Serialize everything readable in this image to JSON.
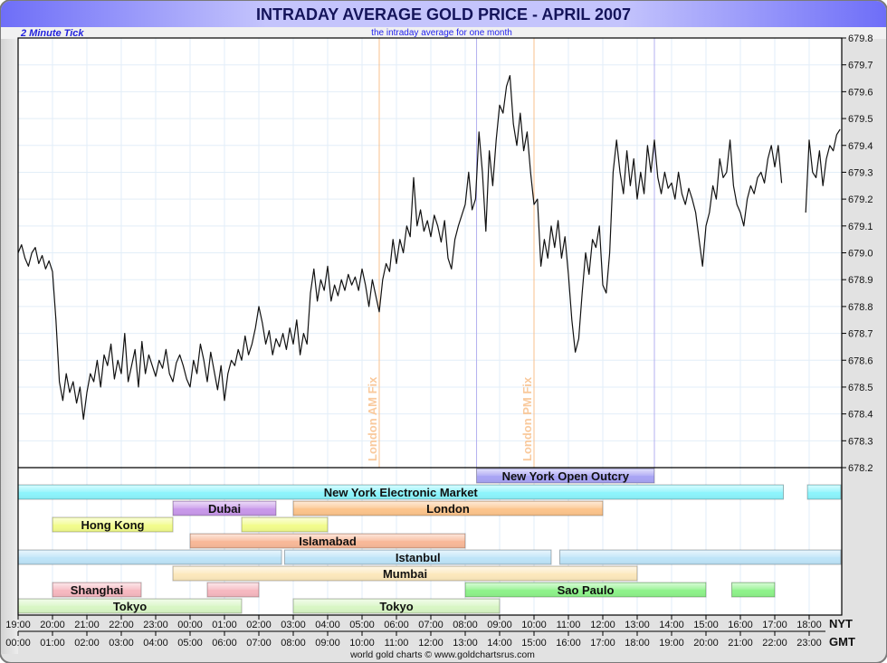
{
  "chart_data": {
    "type": "line",
    "title": "INTRADAY AVERAGE GOLD PRICE - APRIL 2007",
    "subtitle": "the intraday average for one month",
    "tick_note": "2 Minute Tick",
    "credit": "world gold charts © www.goldchartsrus.com",
    "ylim": [
      678.2,
      679.8
    ],
    "y_ticks": [
      "678.2",
      "678.3",
      "678.4",
      "678.5",
      "678.6",
      "678.7",
      "678.8",
      "678.9",
      "679.0",
      "679.1",
      "679.2",
      "679.3",
      "679.4",
      "679.5",
      "679.6",
      "679.7",
      "679.8"
    ],
    "x_axis_nyt_label": "NYT",
    "x_axis_gmt_label": "GMT",
    "x_ticks_nyt": [
      "19:00",
      "20:00",
      "21:00",
      "22:00",
      "23:00",
      "00:00",
      "01:00",
      "02:00",
      "03:00",
      "04:00",
      "05:00",
      "06:00",
      "07:00",
      "08:00",
      "09:00",
      "10:00",
      "11:00",
      "12:00",
      "13:00",
      "14:00",
      "15:00",
      "16:00",
      "17:00",
      "18:00"
    ],
    "x_ticks_gmt": [
      "00:00",
      "01:00",
      "02:00",
      "03:00",
      "04:00",
      "05:00",
      "06:00",
      "07:00",
      "08:00",
      "09:00",
      "10:00",
      "11:00",
      "12:00",
      "13:00",
      "14:00",
      "15:00",
      "16:00",
      "17:00",
      "18:00",
      "19:00",
      "20:00",
      "21:00",
      "22:00",
      "23:00"
    ],
    "series": [
      {
        "name": "Intraday average gold price",
        "start_hour_nyt": "19:00",
        "step_hours": 0.1,
        "values": [
          679.0,
          679.03,
          678.98,
          678.95,
          679.0,
          679.02,
          678.96,
          678.99,
          678.94,
          678.97,
          678.93,
          678.75,
          678.52,
          678.45,
          678.55,
          678.48,
          678.52,
          678.44,
          678.5,
          678.38,
          678.48,
          678.55,
          678.52,
          678.6,
          678.5,
          678.62,
          678.58,
          678.66,
          678.53,
          678.6,
          678.55,
          678.7,
          678.52,
          678.58,
          678.64,
          678.5,
          678.67,
          678.55,
          678.62,
          678.58,
          678.54,
          678.6,
          678.57,
          678.64,
          678.55,
          678.52,
          678.59,
          678.62,
          678.58,
          678.53,
          678.5,
          678.6,
          678.55,
          678.66,
          678.6,
          678.52,
          678.63,
          678.56,
          678.49,
          678.58,
          678.45,
          678.55,
          678.6,
          678.58,
          678.64,
          678.6,
          678.69,
          678.62,
          678.66,
          678.72,
          678.8,
          678.74,
          678.66,
          678.71,
          678.62,
          678.68,
          678.65,
          678.7,
          678.64,
          678.72,
          678.66,
          678.75,
          678.62,
          678.7,
          678.66,
          678.85,
          678.94,
          678.82,
          678.9,
          678.86,
          678.95,
          678.82,
          678.88,
          678.84,
          678.9,
          678.86,
          678.92,
          678.88,
          678.91,
          678.86,
          678.94,
          678.88,
          678.8,
          678.9,
          678.84,
          678.78,
          678.9,
          678.96,
          678.93,
          679.05,
          678.96,
          679.05,
          679.0,
          679.1,
          679.06,
          679.28,
          679.1,
          679.16,
          679.08,
          679.12,
          679.06,
          679.14,
          679.1,
          679.04,
          679.12,
          678.98,
          678.94,
          679.05,
          679.1,
          679.14,
          679.18,
          679.3,
          679.16,
          679.2,
          679.45,
          679.3,
          679.08,
          679.38,
          679.25,
          679.42,
          679.55,
          679.52,
          679.62,
          679.66,
          679.48,
          679.4,
          679.52,
          679.38,
          679.45,
          679.3,
          679.18,
          679.2,
          678.95,
          679.05,
          678.98,
          679.1,
          679.02,
          679.12,
          678.98,
          679.06,
          678.92,
          678.75,
          678.63,
          678.68,
          678.85,
          679.0,
          678.92,
          679.05,
          679.02,
          679.1,
          678.88,
          678.85,
          679.0,
          679.3,
          679.42,
          679.3,
          679.22,
          679.38,
          679.25,
          679.35,
          679.2,
          679.3,
          679.22,
          679.4,
          679.3,
          679.42,
          679.28,
          679.22,
          679.3,
          679.24,
          679.26,
          679.2,
          679.3,
          679.22,
          679.18,
          679.24,
          679.2,
          679.15,
          679.05,
          678.95,
          679.1,
          679.15,
          679.25,
          679.2,
          679.35,
          679.28,
          679.3,
          679.42,
          679.25,
          679.18,
          679.15,
          679.1,
          679.2,
          679.25,
          679.22,
          679.28,
          679.3,
          679.26,
          679.35,
          679.4,
          679.32,
          679.4,
          679.26,
          null,
          null,
          null,
          null,
          null,
          null,
          679.15,
          679.42,
          679.3,
          679.28,
          679.38,
          679.25,
          679.35,
          679.4,
          679.38,
          679.44,
          679.46
        ]
      }
    ],
    "annotations": [
      {
        "label": "London AM Fix",
        "hour_offset": 10.5,
        "color": "#f8c08e"
      },
      {
        "label": "London PM Fix",
        "hour_offset": 15.0,
        "color": "#f8c08e"
      }
    ],
    "markers": [
      {
        "hour_offset": 13.33,
        "color": "#b4b0f0"
      },
      {
        "hour_offset": 18.5,
        "color": "#b4b0f0"
      }
    ],
    "markets": [
      {
        "name": "New York Open Outcry",
        "row": 0,
        "color": "#a8a4f4",
        "segments": [
          {
            "start": 13.33,
            "end": 18.5,
            "labeled": true
          }
        ]
      },
      {
        "name": "New York Electronic Market",
        "row": 1,
        "color": "#8cf4fc",
        "segments": [
          {
            "start": 0,
            "end": 22.25,
            "labeled": true
          },
          {
            "start": 22.95,
            "end": 23.92,
            "labeled": false
          }
        ]
      },
      {
        "name": "Dubai",
        "row": 2,
        "color": "#c898ea",
        "segments": [
          {
            "start": 4.5,
            "end": 7.5,
            "labeled": true
          }
        ]
      },
      {
        "name": "London",
        "row": 2,
        "color": "#fcc48c",
        "segments": [
          {
            "start": 8,
            "end": 17,
            "labeled": true
          }
        ]
      },
      {
        "name": "Hong Kong",
        "row": 3,
        "color": "#f2fc8c",
        "segments": [
          {
            "start": 1,
            "end": 4.5,
            "labeled": true
          },
          {
            "start": 6.5,
            "end": 9,
            "labeled": false
          }
        ]
      },
      {
        "name": "Islamabad",
        "row": 4,
        "color": "#f8b898",
        "segments": [
          {
            "start": 5,
            "end": 13,
            "labeled": true
          }
        ]
      },
      {
        "name": "Istanbul",
        "row": 5,
        "color": "#bee4f8",
        "segments": [
          {
            "start": 0,
            "end": 7.66,
            "labeled": false
          },
          {
            "start": 7.75,
            "end": 15.5,
            "labeled": true
          },
          {
            "start": 15.75,
            "end": 23.92,
            "labeled": false
          }
        ]
      },
      {
        "name": "Mumbai",
        "row": 6,
        "color": "#fce8bc",
        "segments": [
          {
            "start": 4.5,
            "end": 18,
            "labeled": true
          }
        ]
      },
      {
        "name": "Shanghai",
        "row": 7,
        "color": "#f6b8c0",
        "segments": [
          {
            "start": 1,
            "end": 3.58,
            "labeled": true
          },
          {
            "start": 5.5,
            "end": 7,
            "labeled": false
          }
        ]
      },
      {
        "name": "Sao Paulo",
        "row": 7,
        "color": "#8ef28a",
        "segments": [
          {
            "start": 13,
            "end": 20,
            "labeled": true
          },
          {
            "start": 20.75,
            "end": 22,
            "labeled": false
          }
        ]
      },
      {
        "name": "Tokyo",
        "row": 8,
        "color": "#d8f6c4",
        "segments": [
          {
            "start": 0,
            "end": 6.5,
            "labeled": true
          },
          {
            "start": 8,
            "end": 14,
            "labeled": true
          }
        ]
      }
    ]
  }
}
